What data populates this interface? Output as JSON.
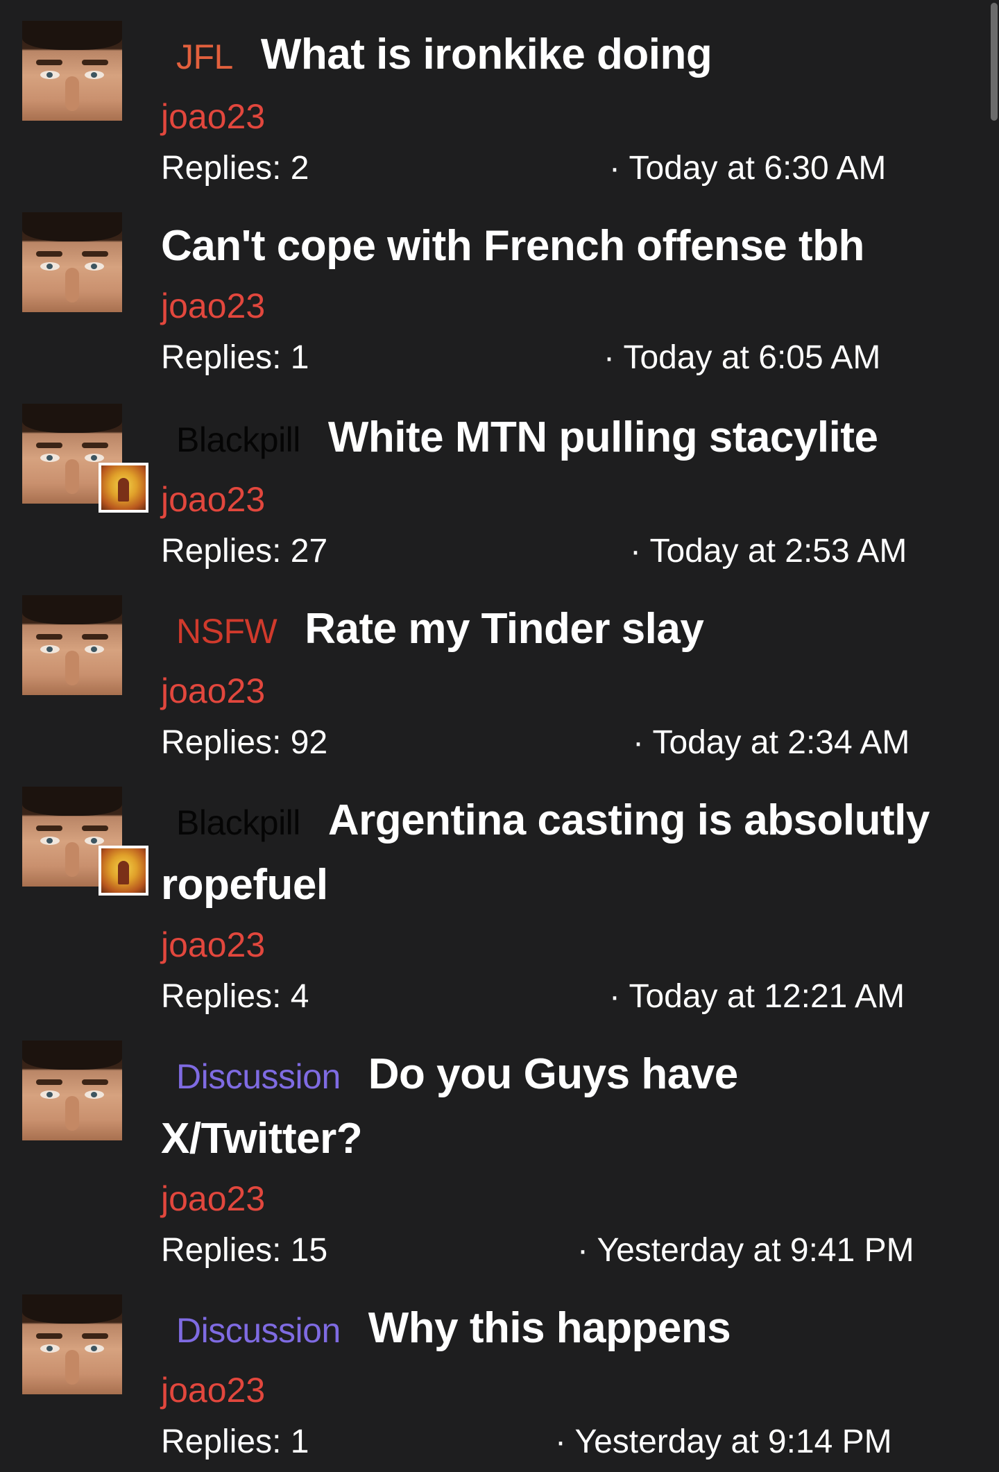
{
  "threads": [
    {
      "prefix": "JFL",
      "title": "What is ironkike doing",
      "author": "joao23",
      "replies": "Replies: 2",
      "date": "· Today at 6:30 AM"
    },
    {
      "prefix": "",
      "title": "Can't cope with French offense tbh",
      "author": "joao23",
      "replies": "Replies: 1",
      "date": "· Today at 6:05 AM"
    },
    {
      "prefix": "Blackpill",
      "title": "White MTN pulling stacylite",
      "author": "joao23",
      "replies": "Replies: 27",
      "date": "· Today at 2:53 AM"
    },
    {
      "prefix": "NSFW",
      "title": "Rate my Tinder slay",
      "author": "joao23",
      "replies": "Replies: 92",
      "date": "· Today at 2:34 AM"
    },
    {
      "prefix": "Blackpill",
      "title": "Argentina casting is absolutly ropefuel",
      "author": "joao23",
      "replies": "Replies: 4",
      "date": "· Today at 12:21 AM"
    },
    {
      "prefix": "Discussion",
      "title": "Do you Guys have X/Twitter?",
      "author": "joao23",
      "replies": "Replies: 15",
      "date": "· Yesterday at 9:41 PM"
    },
    {
      "prefix": "Discussion",
      "title": "Why this happens",
      "author": "joao23",
      "replies": "Replies: 1",
      "date": "· Yesterday at 9:14 PM"
    }
  ],
  "colors": {
    "background": "#1e1e1f",
    "author": "#e2473d",
    "prefix_jfl": "#e2603d",
    "prefix_blackpill": "#050505",
    "prefix_nsfw": "#d03a2c",
    "prefix_discussion": "#7f6be2"
  },
  "icons": {
    "avatar": "user-avatar-photo",
    "badge": "album-cover-badge"
  }
}
